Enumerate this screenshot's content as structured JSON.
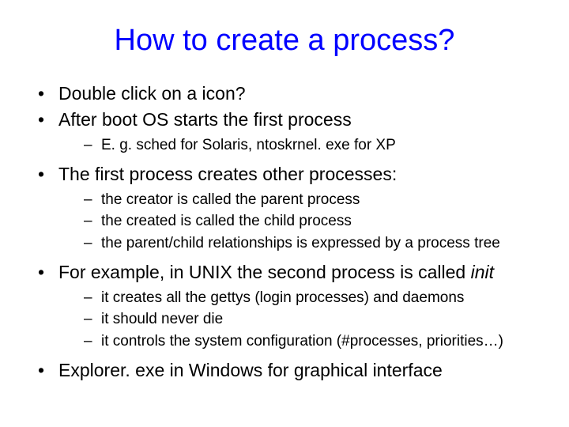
{
  "colors": {
    "title": "#0000ff"
  },
  "title": "How to create a process?",
  "bullets": [
    {
      "text": "Double click on a icon?",
      "sub": []
    },
    {
      "text": "After boot OS starts the first process",
      "sub": [
        "E. g. sched for Solaris, ntoskrnel. exe for XP"
      ]
    },
    {
      "text": "The first process creates other processes:",
      "sub": [
        "the creator is called the parent process",
        "the created is called the child process",
        "the parent/child relationships is expressed by a process tree"
      ]
    },
    {
      "text_prefix": "For example, in UNIX the second process is called ",
      "text_italic": "init",
      "sub": [
        "it creates all the gettys (login processes) and daemons",
        "it should never die",
        "it controls the system configuration (#processes, priorities…)"
      ]
    },
    {
      "text": "Explorer. exe in Windows for graphical interface",
      "sub": []
    }
  ]
}
